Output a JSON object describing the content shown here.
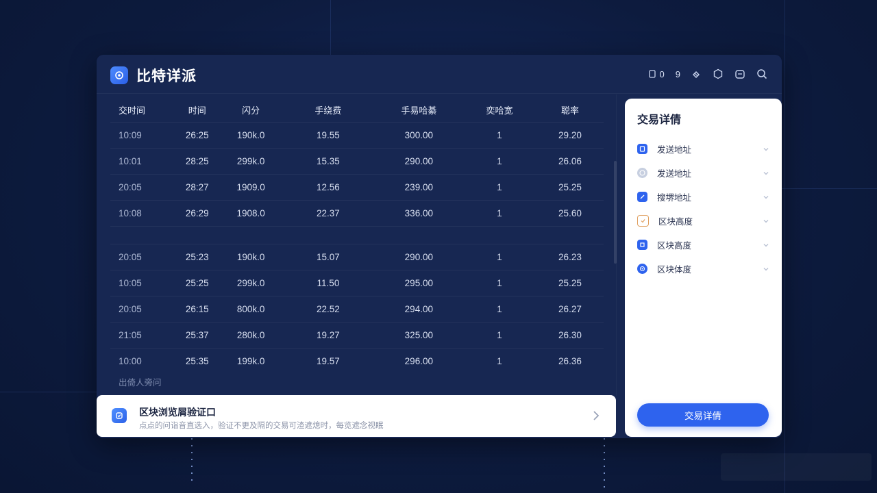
{
  "app": {
    "title": "比特详派"
  },
  "toolbar": {
    "badge_a": "0",
    "badge_b": "9"
  },
  "table": {
    "columns": [
      "交时间",
      "时间",
      "闪分",
      "手绕费",
      "手易哈綦",
      "奕哈宽",
      "聪率"
    ],
    "rows": [
      [
        "10:09",
        "26:25",
        "190k.0",
        "19.55",
        "300.00",
        "1",
        "29.20"
      ],
      [
        "10:01",
        "28:25",
        "299k.0",
        "15.35",
        "290.00",
        "1",
        "26.06"
      ],
      [
        "20:05",
        "28:27",
        "1909.0",
        "12.56",
        "239.00",
        "1",
        "25.25"
      ],
      [
        "10:08",
        "26:29",
        "1908.0",
        "22.37",
        "336.00",
        "1",
        "25.60"
      ],
      [
        "20:05",
        "25:23",
        "190k.0",
        "15.07",
        "290.00",
        "1",
        "26.23"
      ],
      [
        "10:05",
        "25:25",
        "299k.0",
        "11.50",
        "295.00",
        "1",
        "25.25"
      ],
      [
        "20:05",
        "26:15",
        "800k.0",
        "22.52",
        "294.00",
        "1",
        "26.27"
      ],
      [
        "21:05",
        "25:37",
        "280k.0",
        "19.27",
        "325.00",
        "1",
        "26.30"
      ],
      [
        "10:00",
        "25:35",
        "199k.0",
        "19.57",
        "296.00",
        "1",
        "26.36"
      ]
    ],
    "footer": "出倚人旁问"
  },
  "banner": {
    "title": "区块浏览屑验证口",
    "subtitle": "点点的问诣音直选入，验证不更及隔的交易可渣遮熄时，每览遮念视眠"
  },
  "panel": {
    "title": "交易详倩",
    "items": [
      {
        "label": "发送地址",
        "icon": "document-icon",
        "color": "#2e63ee"
      },
      {
        "label": "发送地址",
        "icon": "globe-icon",
        "color": "#9aa6c4"
      },
      {
        "label": "搜堺地址",
        "icon": "edit-icon",
        "color": "#2e63ee"
      },
      {
        "label": "区块高度",
        "icon": "check-box-icon",
        "color": "#e0a060"
      },
      {
        "label": "区块高度",
        "icon": "block-icon",
        "color": "#2e63ee"
      },
      {
        "label": "区块体度",
        "icon": "target-icon",
        "color": "#2e63ee"
      }
    ],
    "button_label": "交易详倩"
  },
  "colors": {
    "accent": "#2e63ee",
    "background": "#0d1b3e",
    "window": "#172752"
  }
}
